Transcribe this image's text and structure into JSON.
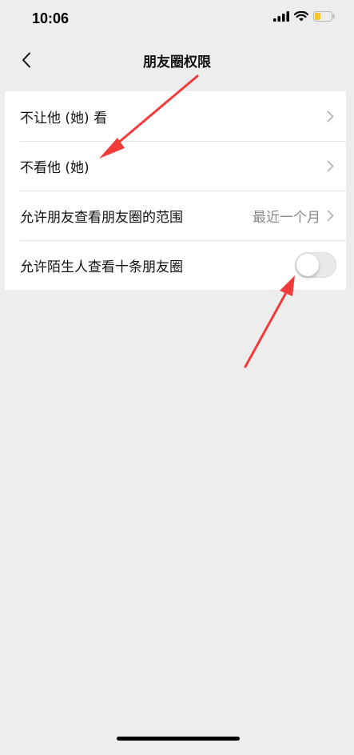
{
  "status_bar": {
    "time": "10:06",
    "icons": [
      "cellular-signal-icon",
      "wifi-icon",
      "battery-low-icon"
    ],
    "battery_color": "#f4c430"
  },
  "nav": {
    "back_icon": "chevron-left-icon",
    "title": "朋友圈权限"
  },
  "settings": {
    "items": [
      {
        "label": "不让他 (她) 看",
        "value": "",
        "control": "chevron"
      },
      {
        "label": "不看他 (她)",
        "value": "",
        "control": "chevron"
      },
      {
        "label": "允许朋友查看朋友圈的范围",
        "value": "最近一个月",
        "control": "chevron"
      },
      {
        "label": "允许陌生人查看十条朋友圈",
        "value": "",
        "control": "toggle",
        "toggle_on": false
      }
    ]
  },
  "annotations": {
    "arrow_color": "#f23c3c",
    "arrows": [
      "arrow-to-hide-from-item",
      "arrow-to-stranger-toggle"
    ]
  }
}
